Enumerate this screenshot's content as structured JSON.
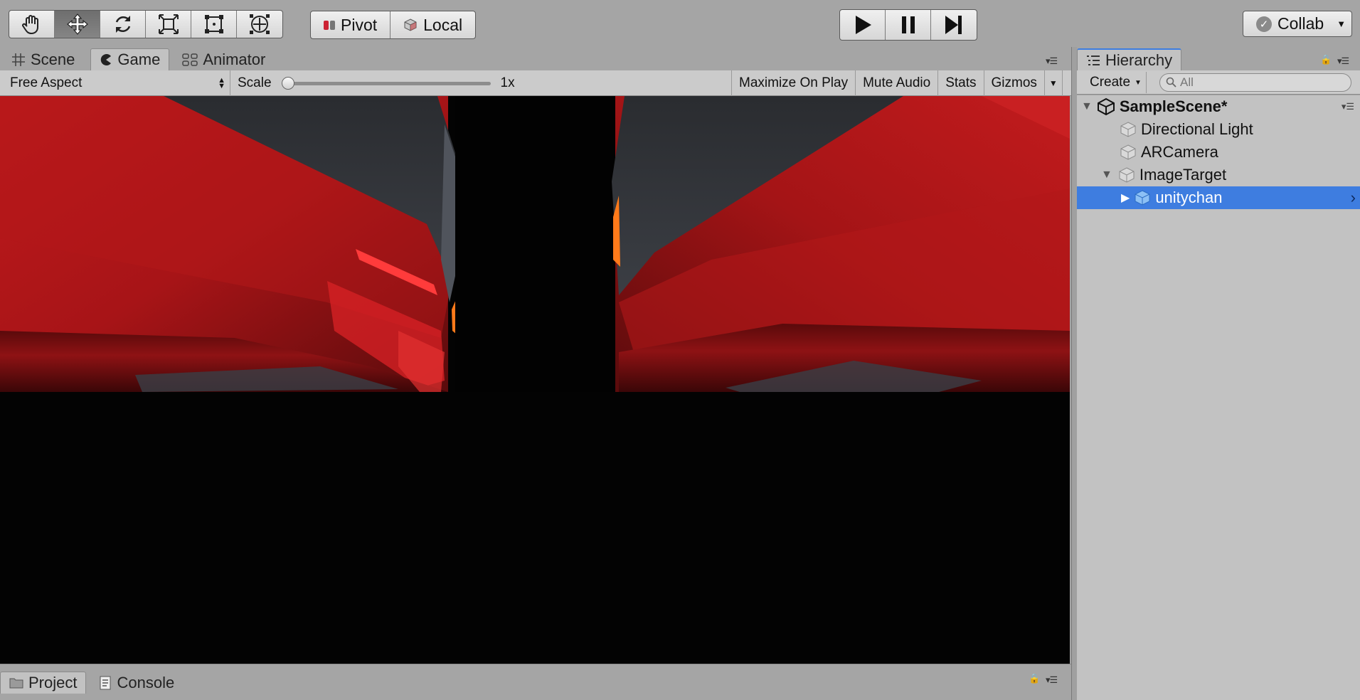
{
  "toolbar": {
    "tools": [
      {
        "icon": "hand-icon"
      },
      {
        "icon": "move-icon",
        "active": true
      },
      {
        "icon": "rotate-icon"
      },
      {
        "icon": "scale-icon"
      },
      {
        "icon": "rect-tool-icon"
      },
      {
        "icon": "transform-icon"
      }
    ],
    "pivot_label": "Pivot",
    "local_label": "Local",
    "collab_label": "Collab"
  },
  "main_tabs": [
    {
      "label": "Scene",
      "icon": "grid-icon"
    },
    {
      "label": "Game",
      "icon": "pacman-icon",
      "active": true
    },
    {
      "label": "Animator",
      "icon": "animator-icon"
    }
  ],
  "game_toolbar": {
    "aspect": "Free Aspect",
    "scale_label": "Scale",
    "scale_value": "1x",
    "scale_fraction": 0,
    "maximize": "Maximize On Play",
    "mute": "Mute Audio",
    "stats": "Stats",
    "gizmos": "Gizmos"
  },
  "hierarchy": {
    "tab_label": "Hierarchy",
    "create_label": "Create",
    "search_placeholder": "All",
    "scene_name": "SampleScene*",
    "items": [
      {
        "label": "Directional Light"
      },
      {
        "label": "ARCamera"
      },
      {
        "label": "ImageTarget",
        "expanded": true
      },
      {
        "label": "unitychan",
        "selected": true
      }
    ]
  },
  "bottom_tabs": [
    {
      "label": "Project",
      "icon": "folder-icon",
      "active": true
    },
    {
      "label": "Console",
      "icon": "console-icon"
    }
  ],
  "colors": {
    "selection": "#3e7de0",
    "editor_bg": "#a5a5a5",
    "panel_bg": "#c2c2c2",
    "render_red": "#b0151a"
  }
}
